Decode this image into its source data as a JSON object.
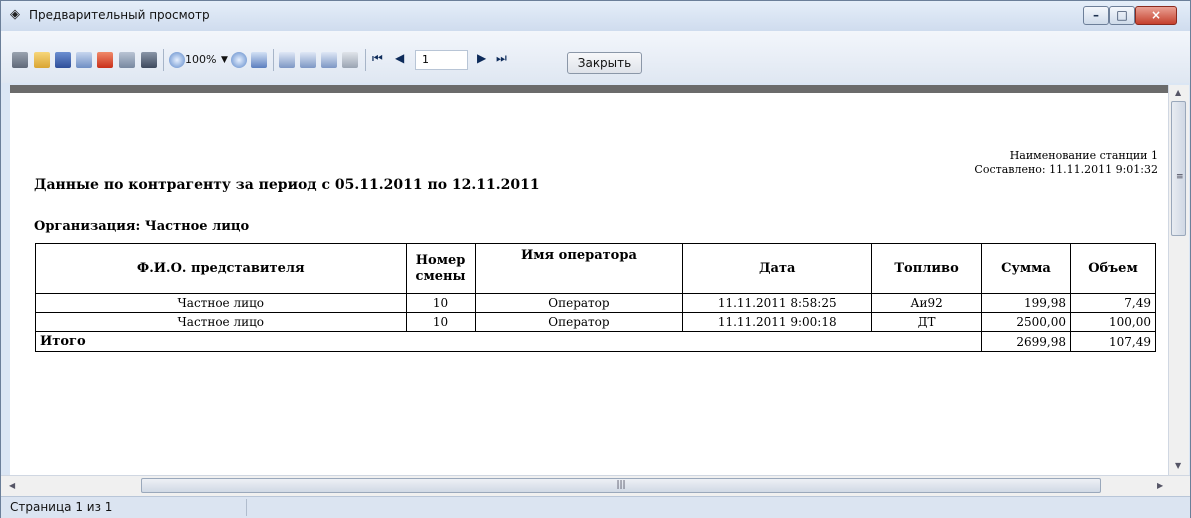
{
  "window": {
    "title": "Предварительный просмотр"
  },
  "titlebar_buttons": {
    "minimize": "–",
    "maximize": "□",
    "close": "×"
  },
  "toolbar": {
    "zoom_value": "100%",
    "page_value": "1",
    "close_label": "Закрыть",
    "icons": [
      "print-icon",
      "open-icon",
      "save-icon",
      "export-icon",
      "pdf-icon",
      "find-icon",
      "binoculars-icon",
      "zoom-in-icon",
      "zoom-out-icon",
      "full-page-icon",
      "single-page-icon",
      "two-pages-icon",
      "multiple-pages-icon",
      "page-setup-icon"
    ],
    "nav": {
      "first": "⏮",
      "prev": "◀",
      "next": "▶",
      "last": "⏭"
    }
  },
  "report": {
    "station_name": "Наименование станции 1",
    "composed": "Составлено:  11.11.2011 9:01:32",
    "title": "Данные по контрагенту за период с 05.11.2011 по 12.11.2011",
    "organization": "Организация: Частное лицо",
    "columns": [
      "Ф.И.О. представителя",
      "Номер смены",
      "Имя оператора",
      "Дата",
      "Топливо",
      "Сумма",
      "Объем"
    ],
    "rows": [
      [
        "Частное лицо",
        "10",
        "Оператор",
        "11.11.2011 8:58:25",
        "Аи92",
        "199,98",
        "7,49"
      ],
      [
        "Частное лицо",
        "10",
        "Оператор",
        "11.11.2011 9:00:18",
        "ДТ",
        "2500,00",
        "100,00"
      ]
    ],
    "total": {
      "label": "Итого",
      "sum": "2699,98",
      "volume": "107,49"
    }
  },
  "status": {
    "page_text": "Страница 1 из 1"
  },
  "colors": {
    "title_bg": "#dbe6f4",
    "accent_close": "#c5402d",
    "dark_bar": "#6b6b6b"
  }
}
